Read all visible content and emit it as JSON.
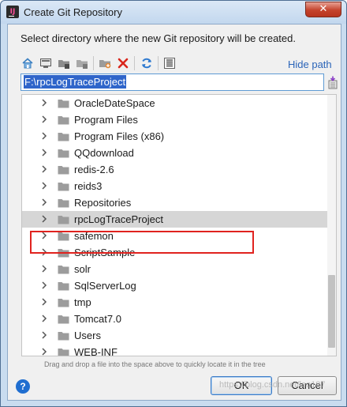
{
  "window": {
    "title": "Create Git Repository",
    "app_icon": "intellij-idea-icon",
    "close_glyph": "✕"
  },
  "description": "Select directory where the new Git repository will be created.",
  "toolbar": {
    "buttons": [
      "home-icon",
      "desktop-icon",
      "project-folder-icon",
      "module-folder-icon",
      "new-folder-icon",
      "delete-icon",
      "refresh-icon",
      "show-hidden-icon"
    ],
    "hide_path_label": "Hide path"
  },
  "path": {
    "value": "F:\\rpcLogTraceProject"
  },
  "tree": {
    "items": [
      {
        "label": "OracleDateSpace"
      },
      {
        "label": "Program Files"
      },
      {
        "label": "Program Files (x86)"
      },
      {
        "label": "QQdownload"
      },
      {
        "label": "redis-2.6"
      },
      {
        "label": "reids3"
      },
      {
        "label": "Repositories"
      },
      {
        "label": "rpcLogTraceProject",
        "selected": true
      },
      {
        "label": "safemon"
      },
      {
        "label": "ScriptSample"
      },
      {
        "label": "solr"
      },
      {
        "label": "SqlServerLog"
      },
      {
        "label": "tmp"
      },
      {
        "label": "Tomcat7.0"
      },
      {
        "label": "Users"
      },
      {
        "label": "WEB-INF"
      }
    ]
  },
  "hint": "Drag and drop a file into the space above to quickly locate it in the tree",
  "buttons": {
    "help": "?",
    "ok": "OK",
    "cancel": "Cancel"
  },
  "watermark": "https://blog.csdn.net/leo187",
  "colors": {
    "selection": "#2f65ca",
    "highlight_box": "#e0231f",
    "link": "#2a64b8",
    "selected_row": "#d6d6d6"
  }
}
